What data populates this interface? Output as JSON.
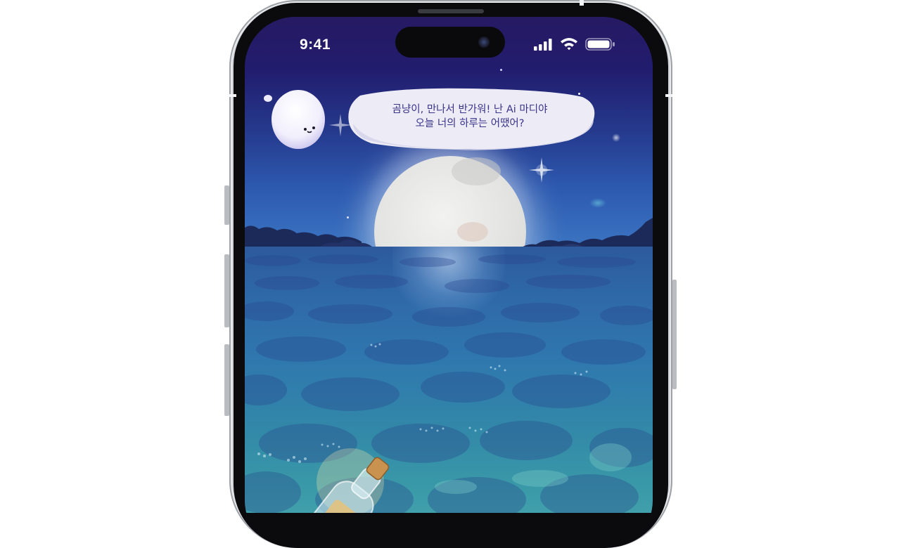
{
  "status_bar": {
    "time": "9:41",
    "icons": [
      "cellular-signal-icon",
      "wifi-icon",
      "battery-icon"
    ]
  },
  "mascot": {
    "name": "Ai 마디야",
    "speech_line_1": "곰냥이, 만나서 반가워! 난 Ai 마디야",
    "speech_line_2": "오늘 너의 하루는 어땠어?"
  },
  "scene": {
    "elements": [
      "moon",
      "night-sky",
      "sea",
      "message-bottle"
    ]
  },
  "colors": {
    "sky_top": "#261a63",
    "sea": "#2f78ae",
    "speech_text": "#39338a",
    "bubble": "#ecebf5"
  }
}
